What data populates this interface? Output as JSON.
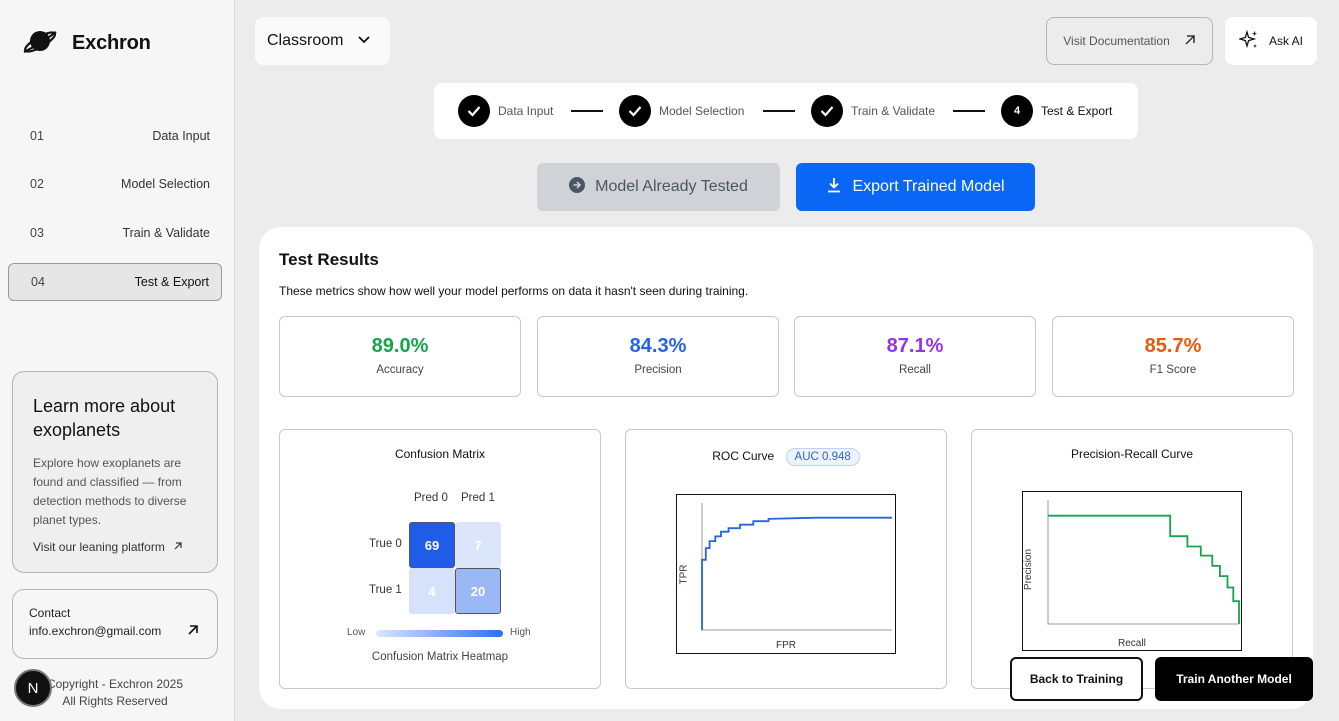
{
  "app": {
    "name": "Exchron"
  },
  "sidebar": {
    "items": [
      {
        "num": "01",
        "label": "Data Input"
      },
      {
        "num": "02",
        "label": "Model Selection"
      },
      {
        "num": "03",
        "label": "Train & Validate"
      },
      {
        "num": "04",
        "label": "Test & Export"
      }
    ],
    "learn": {
      "title": "Learn more about exoplanets",
      "description": "Explore how exoplanets are found and classified — from detection methods to diverse planet types.",
      "link": "Visit our leaning platform"
    },
    "contact": {
      "label": "Contact",
      "email": "info.exchron@gmail.com"
    },
    "copyright_line1": "Copyright - Exchron 2025",
    "copyright_line2": "All Rights Reserved",
    "avatar_letter": "N"
  },
  "header": {
    "workspace": "Classroom",
    "docs_label": "Visit Documentation",
    "ask_ai_label": "Ask AI"
  },
  "stepper": {
    "steps": [
      {
        "label": "Data Input",
        "state": "done"
      },
      {
        "label": "Model Selection",
        "state": "done"
      },
      {
        "label": "Train & Validate",
        "state": "done"
      },
      {
        "label": "Test & Export",
        "state": "current",
        "num": "4"
      }
    ]
  },
  "actions": {
    "tested_label": "Model Already Tested",
    "export_label": "Export Trained Model",
    "back_label": "Back to Training",
    "another_label": "Train Another Model"
  },
  "results": {
    "title": "Test Results",
    "subtitle": "These metrics show how well your model performs on data it hasn't seen during training.",
    "metrics": [
      {
        "value": "89.0%",
        "label": "Accuracy",
        "color": "#16a34a"
      },
      {
        "value": "84.3%",
        "label": "Precision",
        "color": "#2563eb"
      },
      {
        "value": "87.1%",
        "label": "Recall",
        "color": "#9333ea"
      },
      {
        "value": "85.7%",
        "label": "F1 Score",
        "color": "#ea580c"
      }
    ]
  },
  "confusion": {
    "title": "Confusion Matrix",
    "cols": [
      "Pred 0",
      "Pred 1"
    ],
    "rows": [
      "True 0",
      "True 1"
    ],
    "cells": [
      "69",
      "7",
      "4",
      "20"
    ],
    "low": "Low",
    "high": "High",
    "caption": "Confusion Matrix Heatmap"
  },
  "roc": {
    "title": "ROC Curve",
    "auc": "AUC 0.948",
    "xlabel": "FPR",
    "ylabel": "TPR"
  },
  "pr": {
    "title": "Precision-Recall Curve",
    "xlabel": "Recall",
    "ylabel": "Precision"
  },
  "chart_data": [
    {
      "type": "heatmap",
      "title": "Confusion Matrix",
      "x": [
        "Pred 0",
        "Pred 1"
      ],
      "y": [
        "True 0",
        "True 1"
      ],
      "values": [
        [
          69,
          7
        ],
        [
          4,
          20
        ]
      ]
    },
    {
      "type": "line",
      "title": "ROC Curve",
      "xlabel": "FPR",
      "ylabel": "TPR",
      "xlim": [
        0,
        1
      ],
      "ylim": [
        0,
        1
      ],
      "series": [
        {
          "name": "AUC 0.948",
          "x": [
            0,
            0,
            0.02,
            0.02,
            0.04,
            0.04,
            0.07,
            0.07,
            0.1,
            0.1,
            0.14,
            0.14,
            0.2,
            0.2,
            0.27,
            0.27,
            0.35,
            0.35,
            0.6,
            1.0
          ],
          "y": [
            0,
            0.6,
            0.6,
            0.7,
            0.7,
            0.76,
            0.76,
            0.8,
            0.8,
            0.84,
            0.84,
            0.87,
            0.87,
            0.9,
            0.9,
            0.93,
            0.93,
            0.95,
            0.96,
            0.96
          ]
        }
      ]
    },
    {
      "type": "line",
      "title": "Precision-Recall Curve",
      "xlabel": "Recall",
      "ylabel": "Precision",
      "xlim": [
        0,
        1
      ],
      "ylim": [
        0,
        1
      ],
      "series": [
        {
          "x": [
            0,
            0.64,
            0.64,
            0.73,
            0.73,
            0.8,
            0.8,
            0.86,
            0.86,
            0.9,
            0.9,
            0.94,
            0.94,
            0.97,
            0.97,
            1.0,
            1.0
          ],
          "y": [
            0.95,
            0.95,
            0.77,
            0.77,
            0.68,
            0.68,
            0.6,
            0.6,
            0.51,
            0.51,
            0.42,
            0.42,
            0.32,
            0.32,
            0.2,
            0.2,
            0.0
          ]
        }
      ]
    }
  ]
}
